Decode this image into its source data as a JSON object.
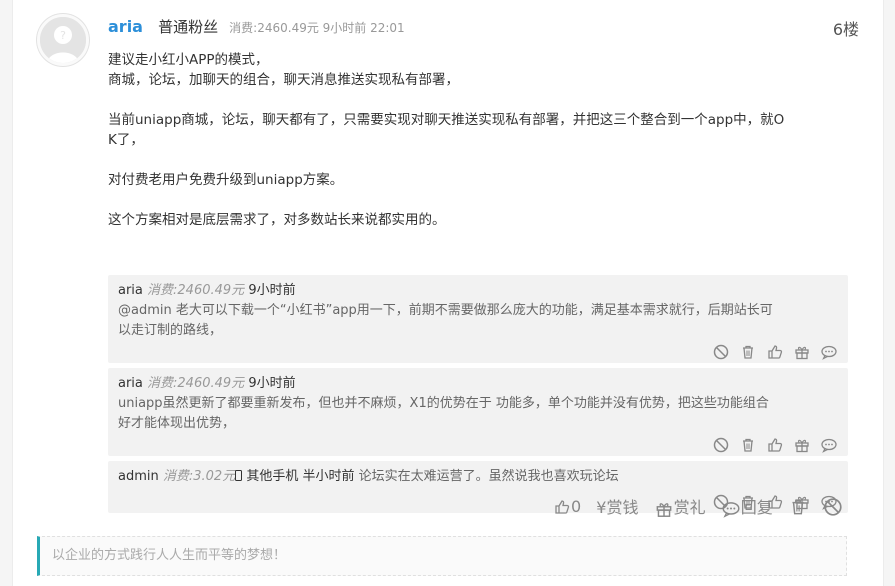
{
  "post": {
    "username": "aria",
    "rank": "普通粉丝",
    "meta": "消费:2460.49元 9小时前 22:01",
    "floor": "6楼",
    "paragraphs": [
      "建议走小红小APP的模式，",
      "商城，论坛，加聊天的组合，聊天消息推送实现私有部署，",
      "",
      "当前uniapp商城，论坛，聊天都有了，只需要实现对聊天推送实现私有部署，并把这三个整合到一个app中，就O",
      "K了，",
      "",
      "对付费老用户免费升级到uniapp方案。",
      "",
      "这个方案相对是底层需求了，对多数站长来说都实用的。"
    ]
  },
  "replies": [
    {
      "name": "aria",
      "consume": "消费:2460.49元",
      "time": "9小时前",
      "lines": [
        "@admin 老大可以下载一个“小红书”app用一下，前期不需要做那么庞大的功能，满足基本需求就行，后期站长可",
        "以走订制的路线，"
      ]
    },
    {
      "name": "aria",
      "consume": "消费:2460.49元",
      "time": "9小时前",
      "lines": [
        "uniapp虽然更新了都要重新发布，但也并不麻烦，X1的优势在于 功能多，单个功能并没有优势，把这些功能组合",
        "好才能体现出优势，"
      ]
    },
    {
      "name": "admin",
      "consume": "消费:3.02元",
      "device": "其他手机",
      "time": "半小时前",
      "text": "论坛实在太难运营了。虽然说我也喜欢玩论坛"
    }
  ],
  "actions": {
    "like_count": "0",
    "reward_money": "赏钱",
    "reward_gift": "赏礼",
    "reply": "回复"
  },
  "signature": "以企业的方式践行人人生而平等的梦想！",
  "colors": {
    "username": "#2c8fd9",
    "signature_accent": "#27a9b5"
  },
  "icons": [
    "avatar-placeholder-icon",
    "ban-icon",
    "trash-icon",
    "thumbs-up-icon",
    "gift-icon",
    "comment-icon",
    "yen-icon",
    "phone-icon"
  ]
}
